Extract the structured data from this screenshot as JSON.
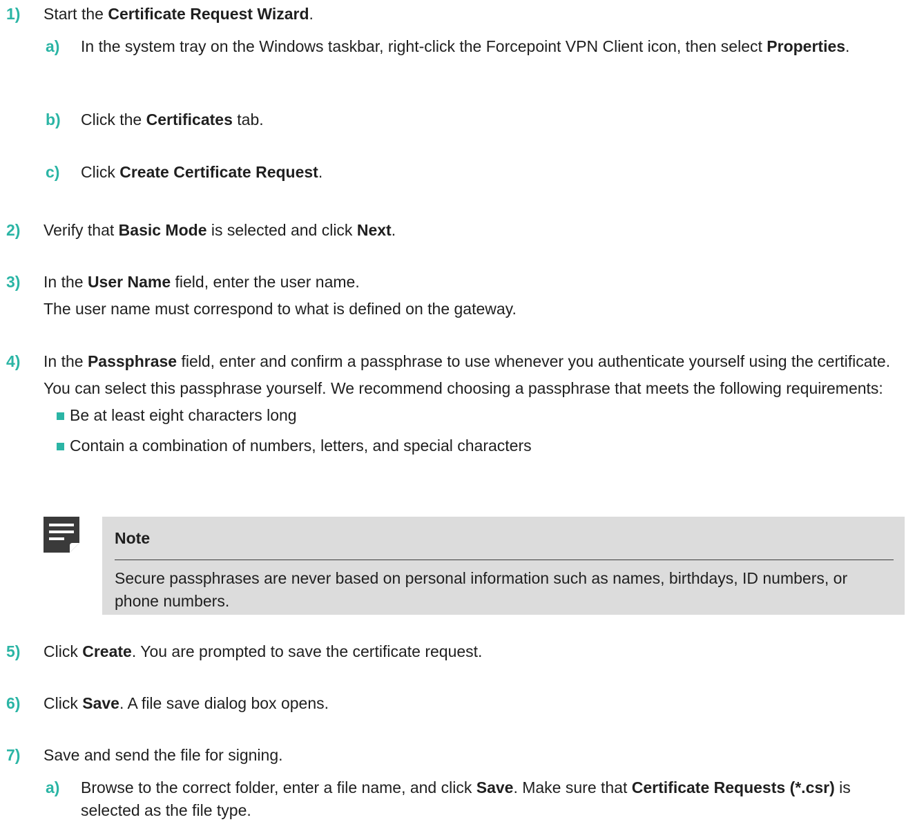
{
  "steps": [
    {
      "num": "1)",
      "pre": "Start the ",
      "bold": "Certificate Request Wizard",
      "post": ".",
      "substeps": [
        {
          "num": "a)",
          "pre": "In the system tray on the Windows taskbar, right-click the Forcepoint VPN Client icon, then select ",
          "bold": "Properties",
          "post": "."
        },
        {
          "num": "b)",
          "pre": "Click the ",
          "bold": "Certificates",
          "post": " tab."
        },
        {
          "num": "c)",
          "pre": "Click ",
          "bold": "Create Certificate Request",
          "post": "."
        }
      ]
    },
    {
      "num": "2)",
      "pre": "Verify that ",
      "bold": "Basic Mode",
      "mid": " is selected and click ",
      "bold2": "Next",
      "post": "."
    },
    {
      "num": "3)",
      "pre": "In the ",
      "bold": "User Name",
      "post": " field, enter the user name.",
      "info": "The user name must correspond to what is defined on the gateway."
    },
    {
      "num": "4)",
      "pre": "In the ",
      "bold": "Passphrase",
      "post": " field, enter and confirm a passphrase to use whenever you authenticate yourself using the certificate.",
      "info": "You can select this passphrase yourself. We recommend choosing a passphrase that meets the following requirements:",
      "bullets": [
        "Be at least eight characters long",
        "Contain a combination of numbers, letters, and special characters"
      ],
      "note": {
        "title": "Note",
        "text": "Secure passphrases are never based on personal information such as names, birthdays, ID numbers, or phone numbers."
      }
    },
    {
      "num": "5)",
      "pre": "Click ",
      "bold": "Create",
      "post": ". You are prompted to save the certificate request."
    },
    {
      "num": "6)",
      "pre": "Click ",
      "bold": "Save",
      "post": ". A file save dialog box opens."
    },
    {
      "num": "7)",
      "pre": "Save and send the file for signing.",
      "substeps": [
        {
          "num": "a)",
          "pre": "Browse to the correct folder, enter a file name, and click ",
          "bold": "Save",
          "mid": ". Make sure that ",
          "bold2": "Certificate Requests (*.csr)",
          "post": " is selected as the file type."
        }
      ]
    }
  ],
  "colors": {
    "accent": "#2bb5a5",
    "note_bg": "#dcdcdc",
    "icon": "#3a3a3a"
  }
}
